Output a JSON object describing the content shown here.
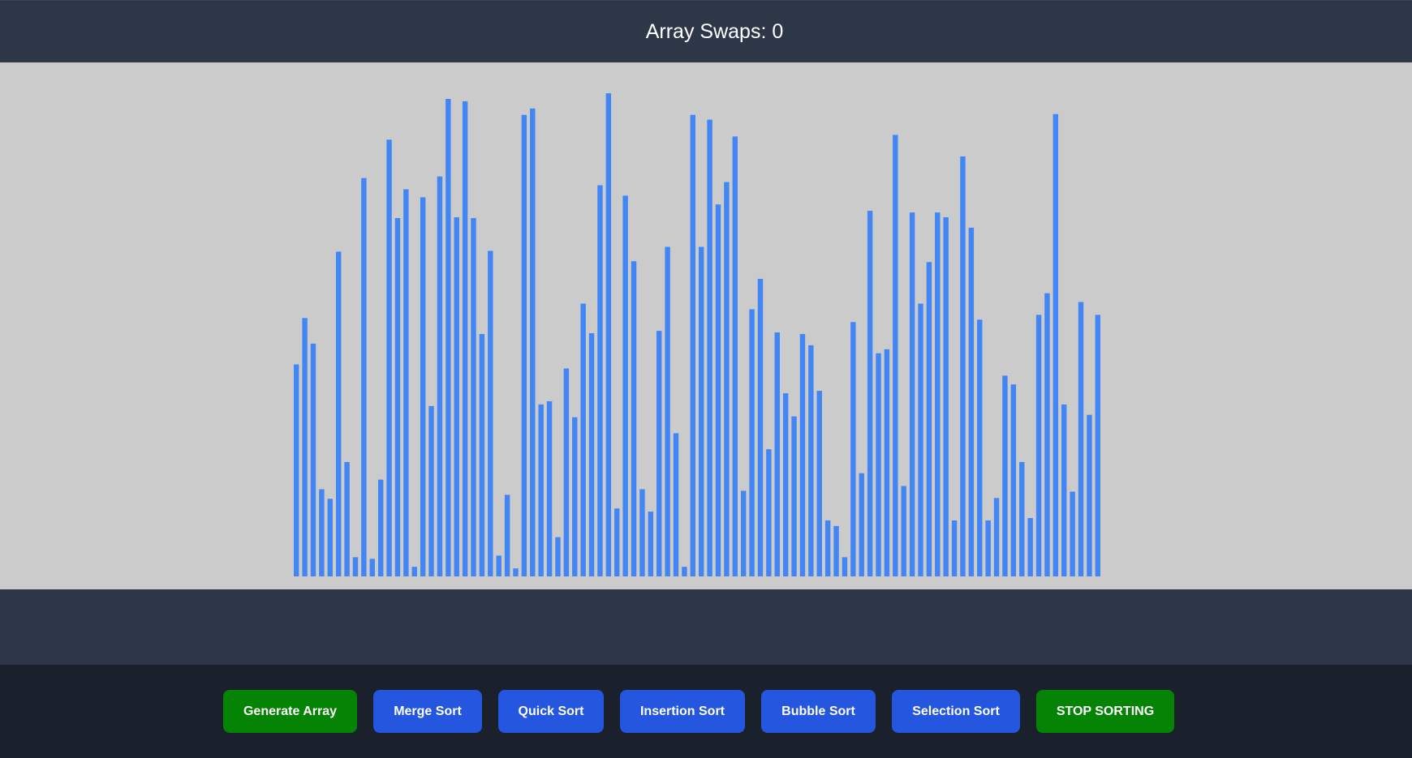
{
  "header": {
    "swaps_label": "Array Swaps:",
    "swaps_count": "0"
  },
  "colors": {
    "bar": "#4285f4",
    "green_button": "#048304",
    "blue_button": "#2456e0",
    "header_bg": "#2d3748",
    "canvas_bg": "#cbcbcb",
    "controls_bg": "#1a202c"
  },
  "controls": {
    "generate_label": "Generate Array",
    "merge_label": "Merge Sort",
    "quick_label": "Quick Sort",
    "insertion_label": "Insertion Sort",
    "bubble_label": "Bubble Sort",
    "selection_label": "Selection Sort",
    "stop_label": "STOP SORTING"
  },
  "chart_data": {
    "type": "bar",
    "ylim": [
      0,
      600
    ],
    "values": [
      265,
      323,
      291,
      109,
      97,
      406,
      143,
      24,
      498,
      22,
      121,
      546,
      448,
      484,
      12,
      474,
      213,
      500,
      597,
      449,
      594,
      448,
      303,
      407,
      26,
      102,
      10,
      577,
      585,
      215,
      219,
      49,
      260,
      199,
      341,
      304,
      489,
      604,
      85,
      476,
      394,
      109,
      81,
      307,
      412,
      179,
      12,
      577,
      412,
      571,
      465,
      493,
      550,
      107,
      334,
      372,
      159,
      305,
      229,
      200,
      303,
      289,
      232,
      70,
      63,
      24,
      318,
      129,
      457,
      279,
      284,
      552,
      113,
      455,
      341,
      393,
      455,
      449,
      70,
      525,
      436,
      321,
      70,
      98,
      251,
      240,
      143,
      73,
      327,
      354,
      578,
      215,
      106,
      343,
      202,
      327
    ]
  }
}
